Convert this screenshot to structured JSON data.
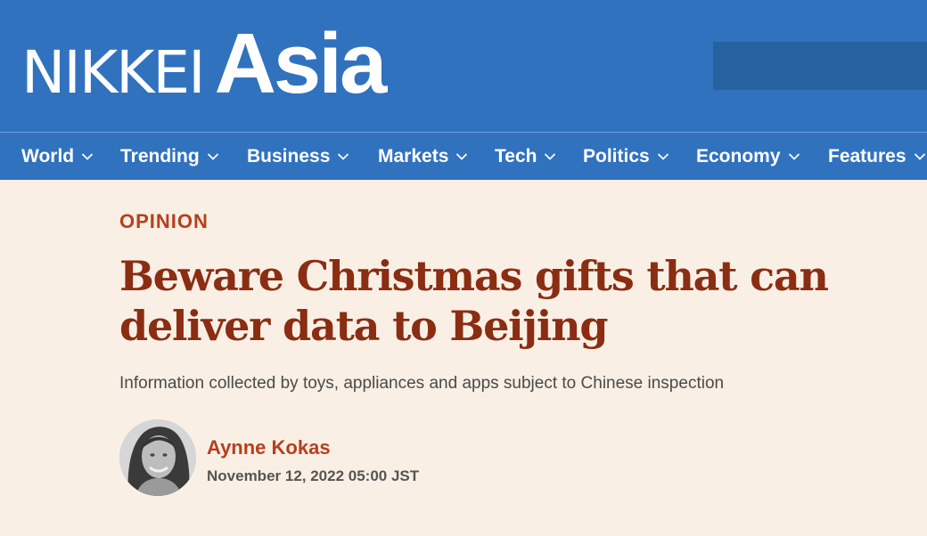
{
  "header": {
    "logo_primary": "NIKKEI",
    "logo_secondary": "Asia"
  },
  "nav": {
    "items": [
      {
        "label": "World"
      },
      {
        "label": "Trending"
      },
      {
        "label": "Business"
      },
      {
        "label": "Markets"
      },
      {
        "label": "Tech"
      },
      {
        "label": "Politics"
      },
      {
        "label": "Economy"
      },
      {
        "label": "Features"
      }
    ],
    "chevron_icon": "chevron-down-icon"
  },
  "article": {
    "kicker": "OPINION",
    "headline": "Beware Christmas gifts that can deliver data to Beijing",
    "subhead": "Information collected by toys, appliances and apps subject to Chinese inspection",
    "author": "Aynne Kokas",
    "date": "November 12, 2022 05:00 JST"
  },
  "colors": {
    "brand_blue": "#3172bf",
    "page_background": "#f9efe4",
    "headline": "#8a2d13",
    "accent": "#b73f1d"
  }
}
